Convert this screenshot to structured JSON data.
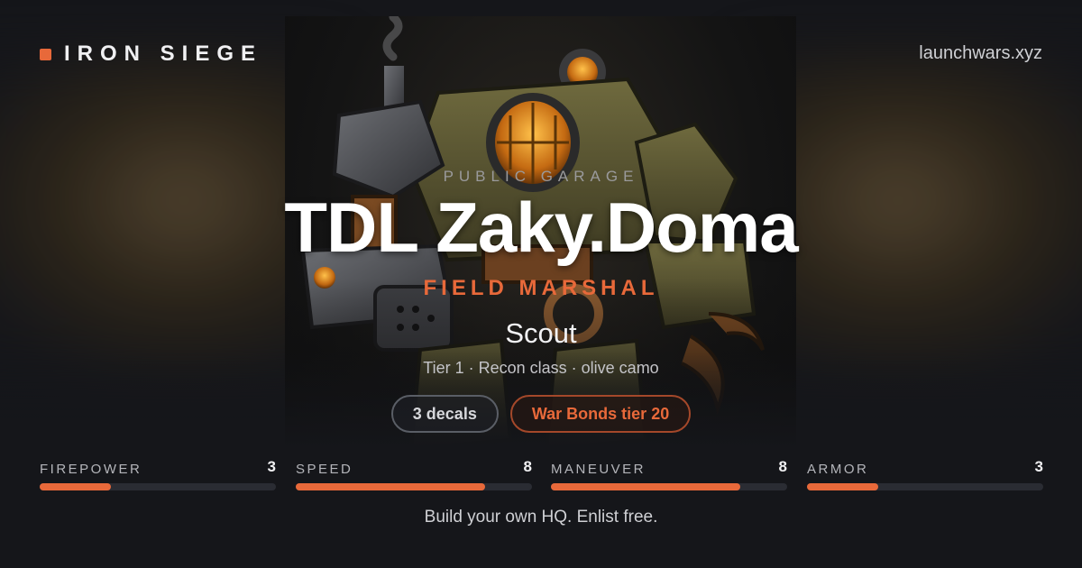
{
  "brand": {
    "name": "IRON SIEGE",
    "site": "launchwars.xyz",
    "accent": "#e8693a"
  },
  "hero": {
    "kicker": "PUBLIC GARAGE",
    "player_name": "TDL Zaky.Doma",
    "rank": "FIELD MARSHAL",
    "mech_name": "Scout",
    "mech_meta": "Tier 1 · Recon class · olive camo"
  },
  "badges": {
    "decals": "3 decals",
    "war_bonds": "War Bonds tier 20"
  },
  "stats": [
    {
      "label": "FIREPOWER",
      "value": "3",
      "fill": 0.3
    },
    {
      "label": "SPEED",
      "value": "8",
      "fill": 0.8
    },
    {
      "label": "MANEUVER",
      "value": "8",
      "fill": 0.8
    },
    {
      "label": "ARMOR",
      "value": "3",
      "fill": 0.3
    }
  ],
  "footer": {
    "cta": "Build your own HQ. Enlist free."
  }
}
